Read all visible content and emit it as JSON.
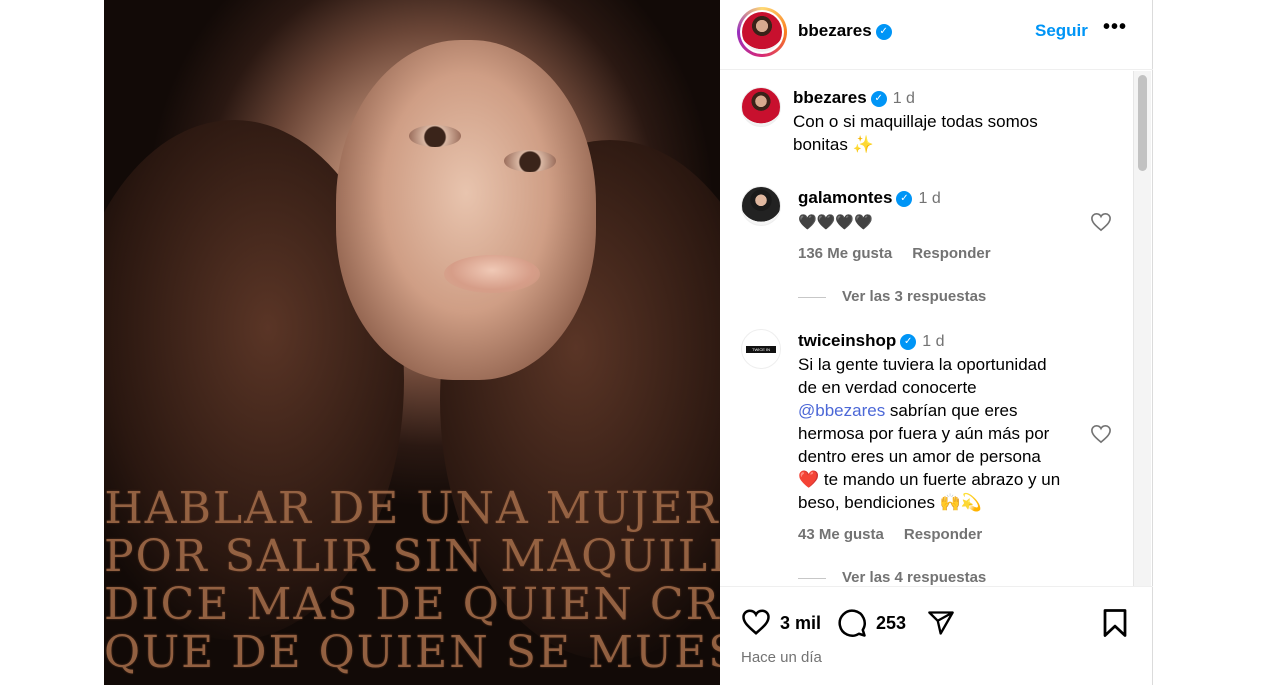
{
  "post": {
    "image_caption_lines": [
      "HABLAR DE UNA MUJER",
      "POR SALIR SIN MAQUILLAJE",
      "DICE MAS DE QUIEN CRITICA",
      "QUE DE QUIEN SE MUESTRA REAL"
    ]
  },
  "header": {
    "username": "bbezares",
    "follow_label": "Seguir",
    "more_label": "•••"
  },
  "caption": {
    "username": "bbezares",
    "time": "1 d",
    "text_line1": "Con o si maquillaje todas somos",
    "text_line2": "bonitas ✨"
  },
  "comments": [
    {
      "username": "galamontes",
      "time": "1 d",
      "text": "🖤🖤🖤🖤",
      "likes": "136 Me gusta",
      "reply_label": "Responder",
      "view_replies": "Ver las 3 respuestas"
    },
    {
      "username": "twiceinshop",
      "time": "1 d",
      "logo_text": "TWICE IN SHOP",
      "line1": "Si la gente tuviera la oportunidad",
      "line2": "de en verdad conocerte",
      "mention": "@bbezares",
      "line3_rest": " sabrían que eres",
      "line4": "hermosa por fuera y aún más por",
      "line5": "dentro eres un amor de persona",
      "line6": "❤️ te mando un fuerte abrazo y un",
      "line7": "beso, bendiciones 🙌💫",
      "likes": "43 Me gusta",
      "reply_label": "Responder",
      "view_replies": "Ver las 4 respuestas"
    }
  ],
  "actions": {
    "likes_count": "3 mil",
    "comments_count": "253",
    "time_ago": "Hace un día"
  },
  "icons": [
    "heart-icon",
    "comment-icon",
    "share-icon",
    "bookmark-icon",
    "verified-badge-icon",
    "more-options-icon"
  ],
  "colors": {
    "accent": "#0095f6",
    "mention": "#4c68d7",
    "muted": "#737373"
  }
}
